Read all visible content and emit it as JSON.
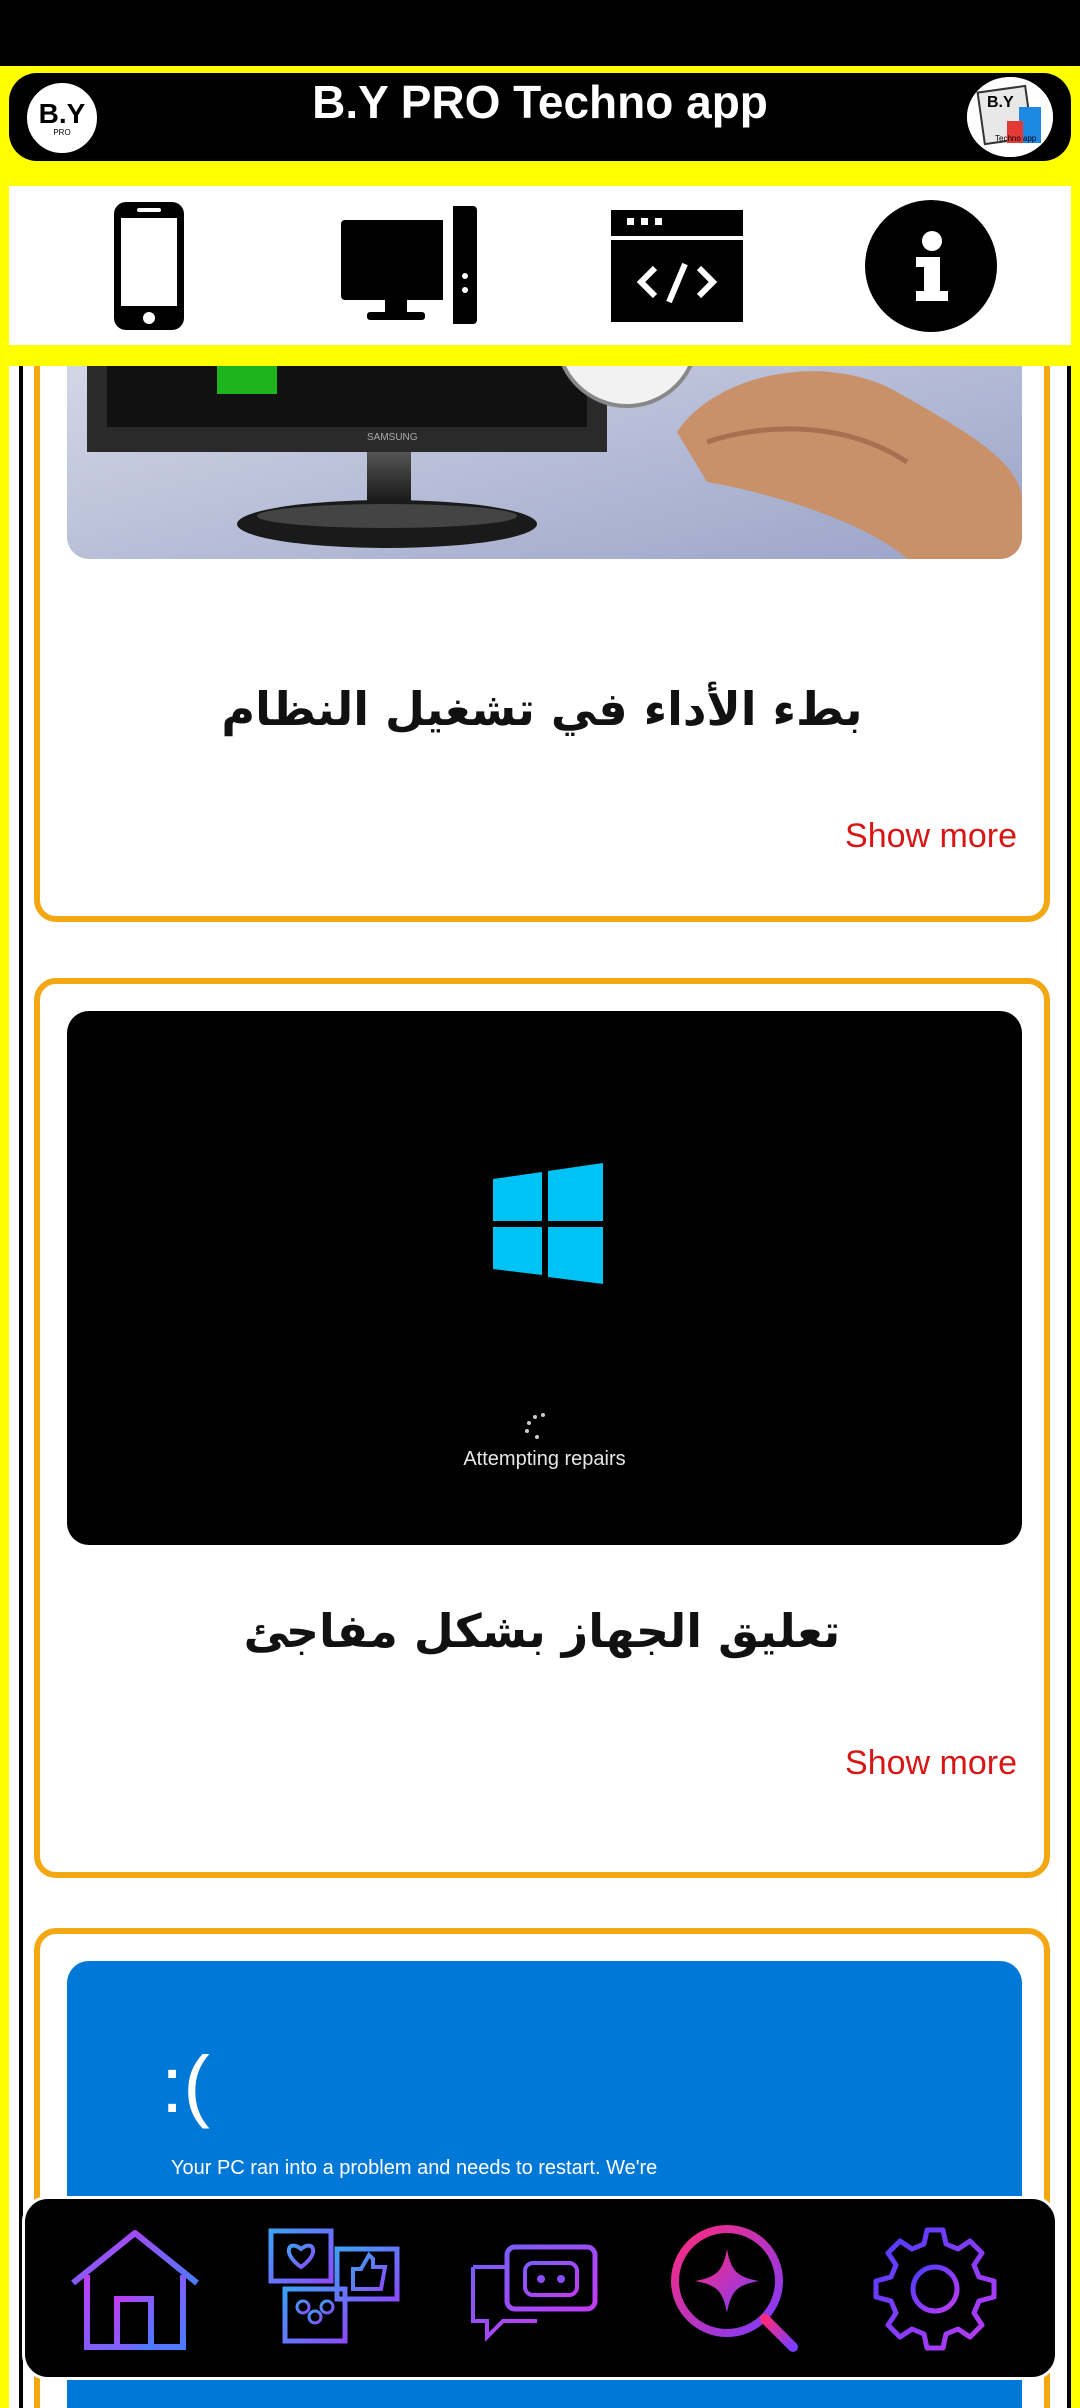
{
  "app": {
    "title": "B.Y PRO Techno app",
    "logo_left": {
      "main": "B.Y",
      "sub": "PRO"
    },
    "logo_right": {
      "main": "B.Y",
      "sub": "Techno app"
    }
  },
  "top_nav": [
    {
      "icon": "smartphone-icon"
    },
    {
      "icon": "desktop-computer-icon"
    },
    {
      "icon": "code-window-icon"
    },
    {
      "icon": "info-icon"
    }
  ],
  "cards": [
    {
      "title": "بطء الأداء في تشغيل النظام",
      "show_more": "Show more",
      "image": "monitor-stopwatch-image"
    },
    {
      "title": "تعليق الجهاز بشكل مفاجئ",
      "show_more": "Show more",
      "image": "windows-repair-image",
      "image_caption": "Attempting repairs"
    },
    {
      "image": "blue-screen-image",
      "image_face": ":(",
      "image_text": "Your PC ran into a problem and needs to restart. We're"
    }
  ],
  "bottom_nav": [
    {
      "icon": "home-icon"
    },
    {
      "icon": "community-feedback-icon"
    },
    {
      "icon": "chatbot-icon"
    },
    {
      "icon": "sparkle-search-icon"
    },
    {
      "icon": "settings-gear-icon"
    }
  ],
  "colors": {
    "frame": "#ffff00",
    "card_border": "#f3a712",
    "show_more": "#d81616",
    "bsod_blue": "#0078d7",
    "windows_logo": "#00c3f5"
  }
}
